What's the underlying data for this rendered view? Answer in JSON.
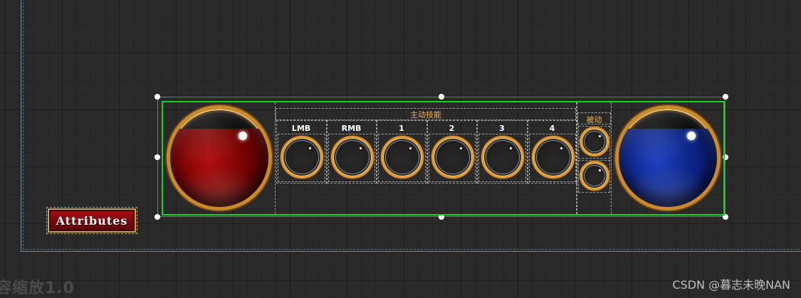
{
  "canvas": {
    "bounds_color": "#3fa3e0",
    "selection_outline_color": "#19d02a"
  },
  "attributes_button": {
    "label": "Attributes",
    "color": "#a80f14"
  },
  "hud": {
    "health_orb": {
      "color": "#b10d0d",
      "fill_level": 0.8
    },
    "mana_orb": {
      "color": "#1b3fc0",
      "fill_level": 0.8
    },
    "active_skills": {
      "title": "主动技能",
      "slots": [
        {
          "label": "LMB"
        },
        {
          "label": "RMB"
        },
        {
          "label": "1"
        },
        {
          "label": "2"
        },
        {
          "label": "3"
        },
        {
          "label": "4"
        }
      ]
    },
    "passive_skills": {
      "title": "被动",
      "slot_count": 2
    }
  },
  "zoom_label": "容缩放1.0",
  "watermark": "CSDN @暮志未晚NAN"
}
